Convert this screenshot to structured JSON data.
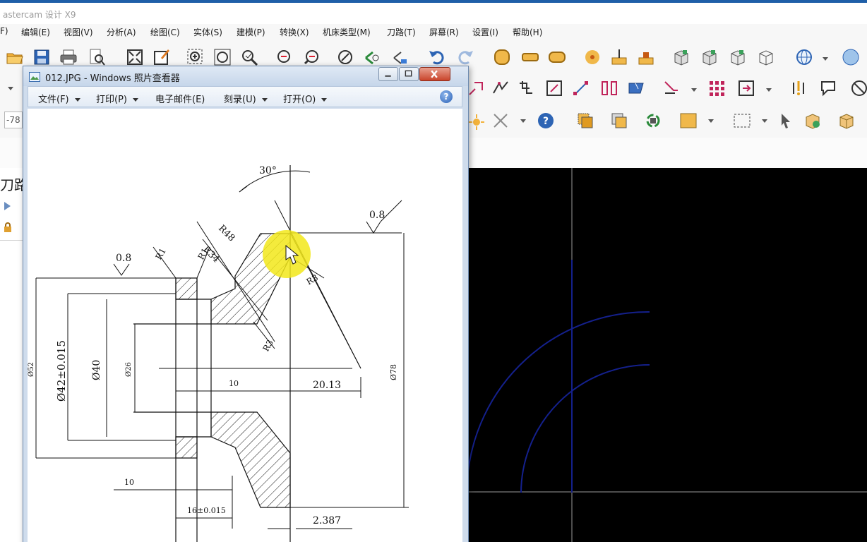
{
  "mastercam": {
    "title": "astercam 设计 X9",
    "menu": [
      "F)",
      "编辑(E)",
      "视图(V)",
      "分析(A)",
      "绘图(C)",
      "实体(S)",
      "建模(P)",
      "转换(X)",
      "机床类型(M)",
      "刀路(T)",
      "屏幕(R)",
      "设置(I)",
      "帮助(H)"
    ],
    "coord_field": "-78",
    "left_panel_label": "刀路",
    "colors": {
      "viewport_bg": "#000000",
      "arc_color": "#14208c",
      "axis_color": "#9a9a9a"
    }
  },
  "viewer": {
    "title": "012.JPG - Windows 照片查看器",
    "menu": [
      {
        "label": "文件(F)",
        "dropdown": true
      },
      {
        "label": "打印(P)",
        "dropdown": true
      },
      {
        "label": "电子邮件(E)",
        "dropdown": false
      },
      {
        "label": "刻录(U)",
        "dropdown": true
      },
      {
        "label": "打开(O)",
        "dropdown": true
      }
    ],
    "help": "?"
  },
  "drawing": {
    "angle": "30°",
    "roughness_top": "0.8",
    "roughness_left": "0.8",
    "r48": "R48",
    "r34": "R34",
    "r1_a": "R1",
    "r1_b": "R1",
    "r3_top": "R3",
    "r3_bottom": "R3",
    "dia_52": "Ø52",
    "dia_42": "Ø42±0.015",
    "dia_40": "Ø40",
    "dia_26": "Ø26",
    "dia_78": "Ø78",
    "len_10_a": "10",
    "len_20_13": "20.13",
    "len_10_b": "10",
    "len_16": "16±0.015",
    "len_2_387": "2.387"
  }
}
